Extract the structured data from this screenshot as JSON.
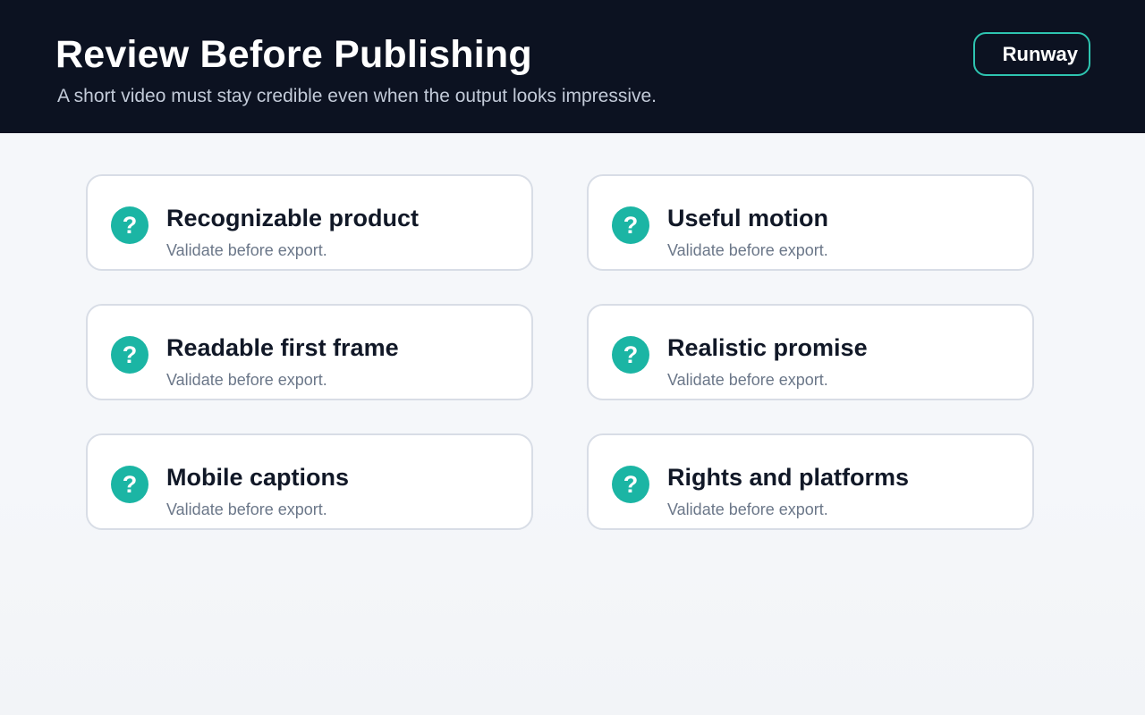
{
  "header": {
    "title": "Review Before Publishing",
    "subtitle": "A short video must stay credible even when the output looks impressive.",
    "badge_label": "Runway"
  },
  "checklist": {
    "icon": "question-icon",
    "icon_glyph": "?",
    "accent_color": "#1bb5a4",
    "items": [
      {
        "title": "Recognizable product",
        "subtitle": "Validate before export."
      },
      {
        "title": "Useful motion",
        "subtitle": "Validate before export."
      },
      {
        "title": "Readable first frame",
        "subtitle": "Validate before export."
      },
      {
        "title": "Realistic promise",
        "subtitle": "Validate before export."
      },
      {
        "title": "Mobile captions",
        "subtitle": "Validate before export."
      },
      {
        "title": "Rights and platforms",
        "subtitle": "Validate before export."
      }
    ]
  },
  "colors": {
    "header_bg": "#0c1221",
    "page_bg": "#f5f7fa",
    "badge_border": "#2ec4b0",
    "title_text": "#111827",
    "muted_text": "#6b7789"
  }
}
